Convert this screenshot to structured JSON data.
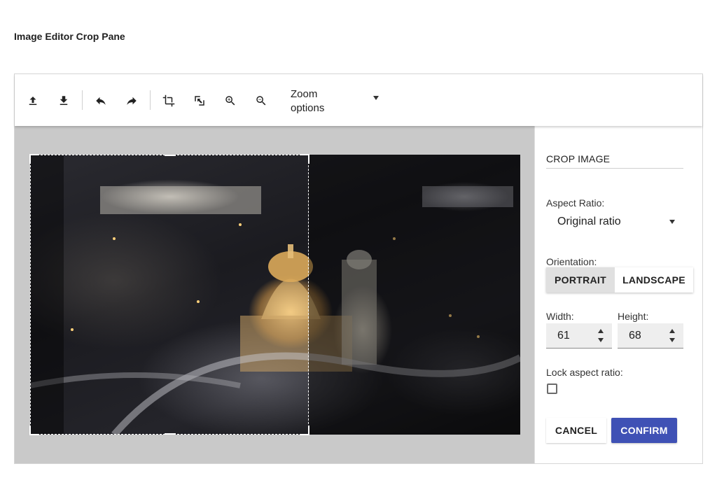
{
  "page": {
    "title": "Image Editor Crop Pane"
  },
  "toolbar": {
    "icons": [
      "upload-icon",
      "download-icon",
      "undo-icon",
      "redo-icon",
      "crop-icon",
      "reset-image-icon",
      "zoom-in-icon",
      "zoom-out-icon"
    ],
    "zoom_select": {
      "label": "Zoom options"
    }
  },
  "crop_panel": {
    "title": "CROP IMAGE",
    "aspect_ratio": {
      "label": "Aspect Ratio:",
      "value": "Original ratio"
    },
    "orientation": {
      "label": "Orientation:",
      "options": [
        "PORTRAIT",
        "LANDSCAPE"
      ],
      "selected": "PORTRAIT"
    },
    "width": {
      "label": "Width:",
      "value": "61"
    },
    "height": {
      "label": "Height:",
      "value": "68"
    },
    "lock_aspect_ratio": {
      "label": "Lock aspect ratio:",
      "checked": false
    },
    "cancel_label": "CANCEL",
    "confirm_label": "CONFIRM"
  },
  "colors": {
    "accent": "#3f51b5",
    "canvas_bg": "#c9c9c9",
    "selected_toggle_bg": "#e0e0e0"
  }
}
